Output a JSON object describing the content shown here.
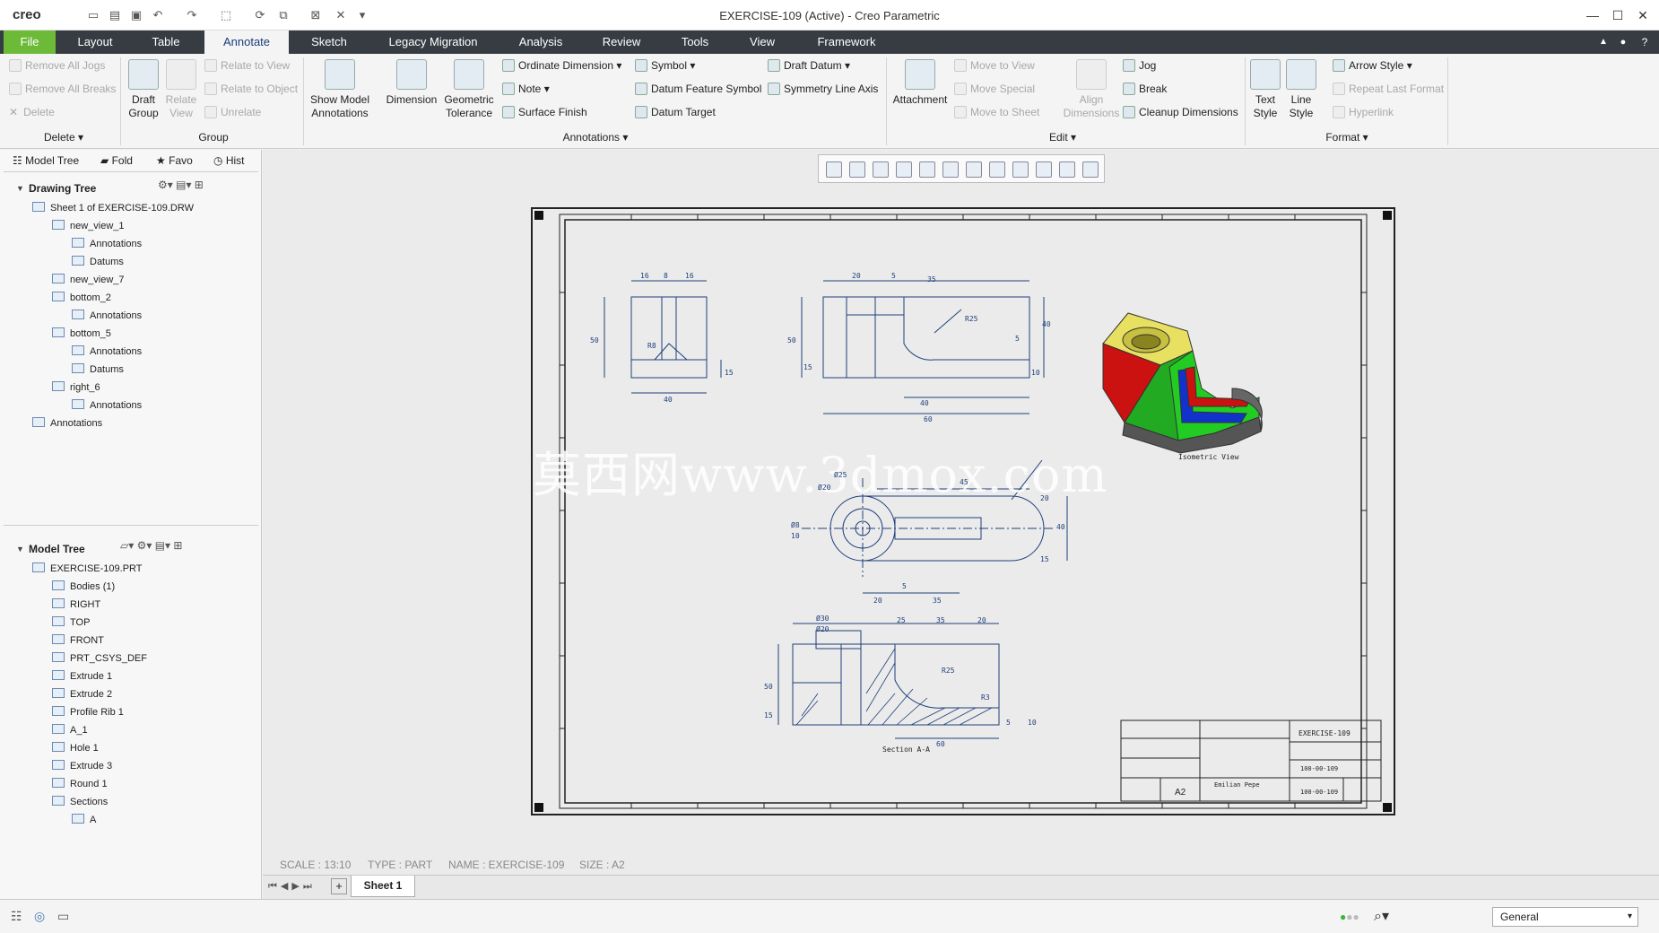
{
  "window": {
    "app_logo": "creo",
    "title": "EXERCISE-109 (Active) - Creo Parametric"
  },
  "menu_tabs": [
    "File",
    "Layout",
    "Table",
    "Annotate",
    "Sketch",
    "Legacy Migration",
    "Analysis",
    "Review",
    "Tools",
    "View",
    "Framework"
  ],
  "ribbon": {
    "delete_group": {
      "remove_all_jogs": "Remove All Jogs",
      "remove_all_breaks": "Remove All Breaks",
      "delete": "Delete",
      "label": "Delete"
    },
    "group_group": {
      "draft_group": "Draft\nGroup",
      "relate_view": "Relate\nView",
      "relate_to_view": "Relate to View",
      "relate_to_object": "Relate to Object",
      "unrelate": "Unrelate",
      "label": "Group"
    },
    "annotations_group": {
      "show_model_annotations": "Show Model\nAnnotations",
      "dimension": "Dimension",
      "geometric_tolerance": "Geometric\nTolerance",
      "ordinate_dimension": "Ordinate Dimension",
      "note": "Note",
      "surface_finish": "Surface Finish",
      "symbol": "Symbol",
      "datum_feature_symbol": "Datum Feature Symbol",
      "datum_target": "Datum Target",
      "draft_datum": "Draft Datum",
      "symmetry_line_axis": "Symmetry Line Axis",
      "label": "Annotations"
    },
    "edit_group": {
      "attachment": "Attachment",
      "move_to_view": "Move to View",
      "move_special": "Move Special",
      "move_to_sheet": "Move to Sheet",
      "align_dimensions": "Align\nDimensions",
      "jog": "Jog",
      "break": "Break",
      "cleanup_dimensions": "Cleanup Dimensions",
      "label": "Edit"
    },
    "format_group": {
      "text_style": "Text\nStyle",
      "line_style": "Line\nStyle",
      "arrow_style": "Arrow Style",
      "repeat_last_format": "Repeat Last Format",
      "hyperlink": "Hyperlink",
      "label": "Format"
    }
  },
  "left_panel": {
    "tabs": [
      "Model Tree",
      "Fold",
      "Favo",
      "Hist"
    ],
    "drawing_tree": {
      "header": "Drawing Tree",
      "items": [
        {
          "label": "Sheet 1 of EXERCISE-109.DRW",
          "indent": 0
        },
        {
          "label": "new_view_1",
          "indent": 1
        },
        {
          "label": "Annotations",
          "indent": 2
        },
        {
          "label": "Datums",
          "indent": 2
        },
        {
          "label": "new_view_7",
          "indent": 1
        },
        {
          "label": "bottom_2",
          "indent": 1
        },
        {
          "label": "Annotations",
          "indent": 2
        },
        {
          "label": "bottom_5",
          "indent": 1
        },
        {
          "label": "Annotations",
          "indent": 2
        },
        {
          "label": "Datums",
          "indent": 2
        },
        {
          "label": "right_6",
          "indent": 1
        },
        {
          "label": "Annotations",
          "indent": 2
        },
        {
          "label": "Annotations",
          "indent": 0
        }
      ]
    },
    "model_tree": {
      "header": "Model Tree",
      "items": [
        {
          "label": "EXERCISE-109.PRT",
          "indent": 0
        },
        {
          "label": "Bodies (1)",
          "indent": 1
        },
        {
          "label": "RIGHT",
          "indent": 1
        },
        {
          "label": "TOP",
          "indent": 1
        },
        {
          "label": "FRONT",
          "indent": 1
        },
        {
          "label": "PRT_CSYS_DEF",
          "indent": 1
        },
        {
          "label": "Extrude 1",
          "indent": 1
        },
        {
          "label": "Extrude 2",
          "indent": 1
        },
        {
          "label": "Profile Rib 1",
          "indent": 1
        },
        {
          "label": "A_1",
          "indent": 1
        },
        {
          "label": "Hole 1",
          "indent": 1
        },
        {
          "label": "Extrude 3",
          "indent": 1
        },
        {
          "label": "Round 1",
          "indent": 1
        },
        {
          "label": "Sections",
          "indent": 1
        },
        {
          "label": "A",
          "indent": 2
        }
      ]
    }
  },
  "drawing": {
    "watermark": "莫西网www.3dmox.com",
    "iso_label": "Isometric View",
    "section_label": "Section A-A",
    "title_block": {
      "part_name": "EXERCISE-109",
      "size": "A2",
      "code": "100-00-109",
      "author": "Emilian Pepe"
    },
    "dims_front": [
      "16",
      "8",
      "16",
      "40",
      "50",
      "15",
      "R8"
    ],
    "dims_top": [
      "20",
      "5",
      "35",
      "40",
      "60",
      "R25",
      "50",
      "15",
      "40",
      "5",
      "10"
    ],
    "dims_right": [
      "Ø20",
      "Ø25",
      "Ø8",
      "45",
      "10",
      "40",
      "20",
      "15",
      "5",
      "20",
      "35"
    ],
    "dims_section": [
      "Ø30",
      "Ø20",
      "25",
      "35",
      "20",
      "60",
      "R25",
      "R3",
      "50",
      "15",
      "5",
      "10"
    ]
  },
  "status": {
    "scale": "SCALE : 13:10",
    "type": "TYPE : PART",
    "name": "NAME : EXERCISE-109",
    "size": "SIZE : A2"
  },
  "sheet_tabs": [
    "Sheet 1"
  ],
  "filter": {
    "selected": "General"
  },
  "colors": {
    "file_tab": "#6cba38",
    "menu_bar": "#363c42",
    "drawing_line": "#1f3f7a",
    "iso_yellow": "#e8e060",
    "iso_green": "#22cc22",
    "iso_red": "#cc1111",
    "iso_blue": "#1133cc"
  }
}
